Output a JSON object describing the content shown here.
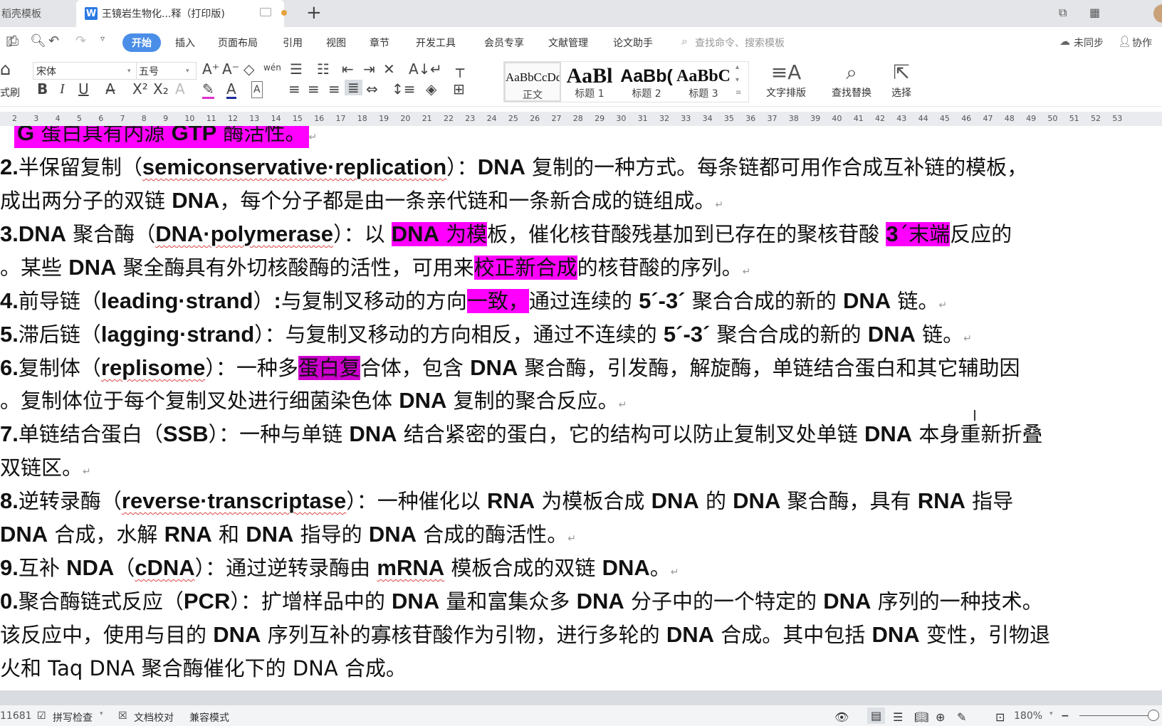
{
  "tabs": {
    "inactive_label": "稻壳模板",
    "active_label": "王镜岩生物化...释（打印版)",
    "app_icon": "W",
    "new_tab_icon": "+"
  },
  "menu": {
    "items": [
      "开始",
      "插入",
      "页面布局",
      "引用",
      "视图",
      "章节",
      "开发工具",
      "会员专享",
      "文献管理",
      "论文助手"
    ],
    "search_placeholder": "查找命令、搜索模板",
    "sync_label": "未同步",
    "collab_label": "协作"
  },
  "ribbon": {
    "format_painter": "式刷",
    "font_name": "宋体",
    "font_size": "五号",
    "pinyin_glyph": "wén",
    "styles": [
      {
        "sample": "AaBbCcDd",
        "label": "正文"
      },
      {
        "sample": "AaBl",
        "label": "标题 1"
      },
      {
        "sample": "AaBb(",
        "label": "标题 2"
      },
      {
        "sample": "AaBbC",
        "label": "标题 3"
      }
    ],
    "text_layout": "文字排版",
    "find_replace": "查找替换",
    "select": "选择"
  },
  "ruler": {
    "ticks": [
      "2",
      "3",
      "4",
      "5",
      "6",
      "7",
      "8",
      "9",
      "10",
      "11",
      "12",
      "13",
      "14",
      "15",
      "16",
      "17",
      "18",
      "19",
      "20",
      "21",
      "22",
      "23",
      "24",
      "25",
      "26",
      "27",
      "28",
      "29",
      "30",
      "31",
      "32",
      "33",
      "34",
      "35",
      "36",
      "37",
      "38",
      "39",
      "40",
      "41",
      "42",
      "43",
      "44",
      "45",
      "46",
      "47",
      "48",
      "49",
      "50",
      "51",
      "52",
      "53"
    ]
  },
  "document": {
    "l0": {
      "b1": "G",
      "t1": " 蛋白具有内源 ",
      "b2": "GTP",
      "t2": " 酶活性。"
    },
    "l1": {
      "num": "2.",
      "t1": "半保留复制（",
      "b1": "semiconservative·replication",
      "t2": "）：",
      "b2": "DNA",
      "t3": " 复制的一种方式。每条链都可用作合成互补链的模板，"
    },
    "l2": {
      "t1": "成出两分子的双链 ",
      "b1": "DNA",
      "t2": "，每个分子都是由一条亲代链和一条新合成的链组成。"
    },
    "l3": {
      "num": "3.",
      "b0": "DNA",
      "t0": " 聚合酶（",
      "b1": "DNA·polymerase",
      "t1": "）：以 ",
      "h1b": "DNA",
      "h1t": " 为模",
      "t2": "板，催化核苷酸残基加到已存在的聚核苷酸 ",
      "h2b": "3",
      "h2t": "´末端",
      "t3": "反应的"
    },
    "l4": {
      "t1": "。某些 ",
      "b1": "DNA",
      "t2": " 聚全酶具有外切核酸酶的活性，可用来",
      "h1": "校正新合成",
      "t3": "的核苷酸的序列。"
    },
    "l5": {
      "num": "4.",
      "t1": "前导链（",
      "b1": "leading·strand",
      "t2": "）",
      "b2": ":",
      "t3": "与复制叉移动的方向",
      "h1": "一致，",
      "t4": "通过连续的 ",
      "b3": "5´-3´",
      "t5": " 聚合合成的新的 ",
      "b4": "DNA",
      "t6": " 链。"
    },
    "l6": {
      "num": "5.",
      "t1": "滞后链（",
      "b1": "lagging·strand",
      "t2": "）：与复制叉移动的方向相反，通过不连续的 ",
      "b2": "5´-3´",
      "t3": " 聚合合成的新的 ",
      "b3": "DNA",
      "t4": " 链。"
    },
    "l7": {
      "num": "6.",
      "t1": "复制体（",
      "b1": "replisome",
      "t2": "）：一种多",
      "h1": "蛋白复",
      "t3": "合体，包含 ",
      "b2": "DNA",
      "t4": " 聚合酶，引发酶，解旋酶，单链结合蛋白和其它辅助因"
    },
    "l8": {
      "t1": "。复制体位于每个复制叉处进行细菌染色体 ",
      "b1": "DNA",
      "t2": " 复制的聚合反应。"
    },
    "l9": {
      "num": "7.",
      "t1": "单链结合蛋白（",
      "b1": "SSB",
      "t2": "）：一种与单链 ",
      "b2": "DNA",
      "t3": " 结合紧密的蛋白，它的结构可以防止复制叉处单链 ",
      "b3": "DNA",
      "t4": " 本身重新折叠"
    },
    "l10": {
      "t1": "双链区。"
    },
    "l11": {
      "num": "8.",
      "t1": "逆转录酶（",
      "b1": "reverse·transcriptase",
      "t2": "）：一种催化以 ",
      "b2": "RNA",
      "t3": " 为模板合成 ",
      "b3": "DNA",
      "t4": " 的 ",
      "b4": "DNA",
      "t5": " 聚合酶，具有 ",
      "b5": "RNA",
      "t6": " 指导"
    },
    "l12": {
      "b1": "DNA",
      "t1": " 合成，水解 ",
      "b2": "RNA",
      "t2": " 和 ",
      "b3": "DNA",
      "t3": " 指导的 ",
      "b4": "DNA",
      "t4": " 合成的酶活性。"
    },
    "l13": {
      "num": "9.",
      "t1": "互补 ",
      "b1": "NDA",
      "t2": "（",
      "b2": "cDNA",
      "t3": "）：通过逆转录酶由 ",
      "b3": "mRNA",
      "t4": " 模板合成的双链 ",
      "b4": "DNA",
      "t5": "。"
    },
    "l14": {
      "num": "0.",
      "t1": "聚合酶链式反应（",
      "b1": "PCR",
      "t2": "）：扩增样品中的 ",
      "b2": "DNA",
      "t3": " 量和富集众多 ",
      "b3": "DNA",
      "t4": " 分子中的一个特定的 ",
      "b4": "DNA",
      "t5": " 序列的一种技术。"
    },
    "l15": {
      "t1": "该反应中，使用与目的 ",
      "b1": "DNA",
      "t2": " 序列互补的寡核苷酸作为引物，进行多轮的 ",
      "b2": "DNA",
      "t3": " 合成。其中包括 ",
      "b3": "DNA",
      "t4": " 变性，引物退"
    },
    "l16": {
      "t1": "火和 Taq DNA 聚合酶催化下的 DNA 合成。"
    }
  },
  "highlight_colors": {
    "magenta": "#ff00ff",
    "purple": "#cc00cc"
  },
  "status": {
    "word_count": "11681",
    "spell_check": "拼写检查",
    "doc_proof": "文档校对",
    "compat_mode": "兼容模式",
    "zoom": "180%"
  }
}
